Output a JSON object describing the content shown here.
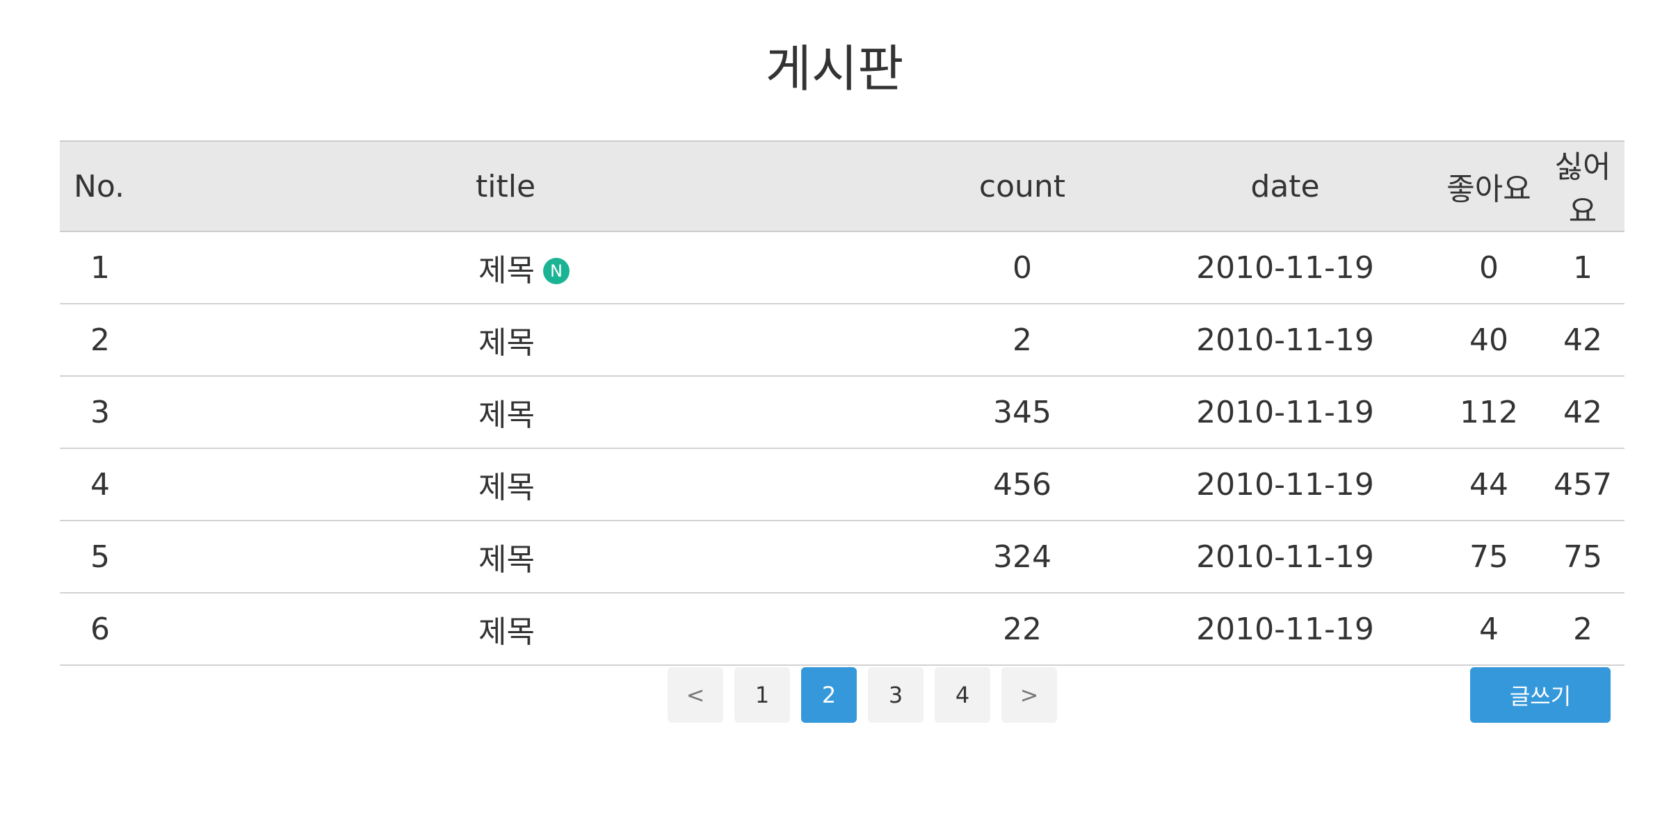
{
  "page": {
    "title": "게시판"
  },
  "table": {
    "headers": {
      "no": "No.",
      "title": "title",
      "count": "count",
      "date": "date",
      "like": "좋아요",
      "dislike": "싫어요"
    },
    "rows": [
      {
        "no": "1",
        "title": "제목",
        "badge": "N",
        "count": "0",
        "date": "2010-11-19",
        "like": "0",
        "dislike": "1"
      },
      {
        "no": "2",
        "title": "제목",
        "count": "2",
        "date": "2010-11-19",
        "like": "40",
        "dislike": "42"
      },
      {
        "no": "3",
        "title": "제목",
        "count": "345",
        "date": "2010-11-19",
        "like": "112",
        "dislike": "42"
      },
      {
        "no": "4",
        "title": "제목",
        "count": "456",
        "date": "2010-11-19",
        "like": "44",
        "dislike": "457"
      },
      {
        "no": "5",
        "title": "제목",
        "count": "324",
        "date": "2010-11-19",
        "like": "75",
        "dislike": "75"
      },
      {
        "no": "6",
        "title": "제목",
        "count": "22",
        "date": "2010-11-19",
        "like": "4",
        "dislike": "2"
      }
    ]
  },
  "pagination": {
    "prev": "<",
    "pages": [
      "1",
      "2",
      "3",
      "4"
    ],
    "current": "2",
    "next": ">"
  },
  "write_button": {
    "label": "글쓰기"
  },
  "colors": {
    "accent": "#3598db",
    "badge": "#1ab394",
    "header_bg": "#e8e8e8"
  }
}
